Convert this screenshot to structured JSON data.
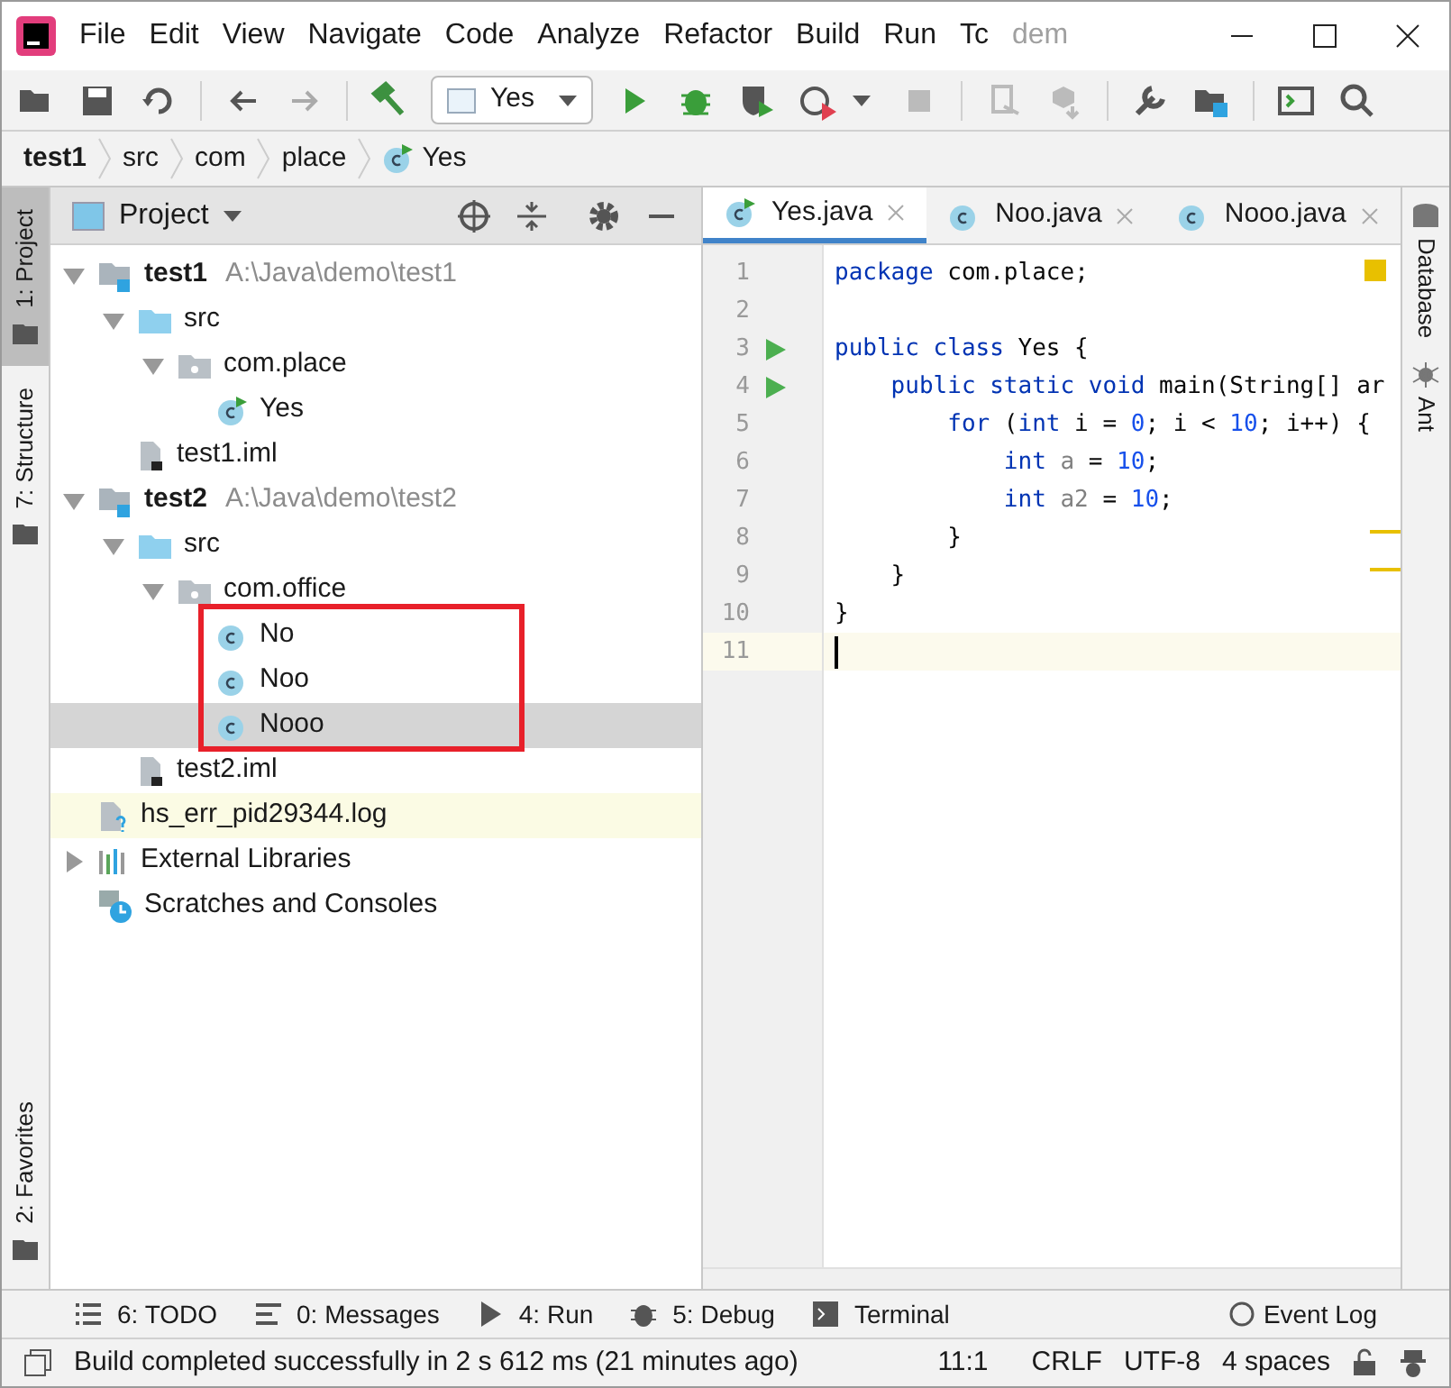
{
  "window": {
    "menu": [
      "File",
      "Edit",
      "View",
      "Navigate",
      "Code",
      "Analyze",
      "Refactor",
      "Build",
      "Run",
      "Tc"
    ],
    "title": "dem"
  },
  "toolbar": {
    "run_config": "Yes"
  },
  "breadcrumb": [
    {
      "label": "test1",
      "kind": "module"
    },
    {
      "label": "src",
      "kind": "dir"
    },
    {
      "label": "com",
      "kind": "dir"
    },
    {
      "label": "place",
      "kind": "dir"
    },
    {
      "label": "Yes",
      "kind": "class"
    }
  ],
  "left_stripe": [
    {
      "label": "1: Project",
      "selected": true
    },
    {
      "label": "7: Structure",
      "selected": false
    }
  ],
  "left_stripe_bottom": [
    {
      "label": "2: Favorites",
      "selected": false
    }
  ],
  "project_panel": {
    "title": "Project",
    "tree": [
      {
        "label": "test1",
        "path": "A:\\Java\\demo\\test1",
        "kind": "module",
        "expanded": true,
        "selected": false,
        "children": [
          {
            "label": "src",
            "kind": "src",
            "expanded": true,
            "selected": false,
            "children": [
              {
                "label": "com.place",
                "kind": "package",
                "expanded": true,
                "selected": false,
                "children": [
                  {
                    "label": "Yes",
                    "kind": "runclass",
                    "selected": false
                  }
                ]
              }
            ]
          },
          {
            "label": "test1.iml",
            "kind": "iml",
            "selected": false
          }
        ]
      },
      {
        "label": "test2",
        "path": "A:\\Java\\demo\\test2",
        "kind": "module",
        "expanded": true,
        "selected": false,
        "children": [
          {
            "label": "src",
            "kind": "src",
            "expanded": true,
            "selected": false,
            "children": [
              {
                "label": "com.office",
                "kind": "package",
                "expanded": true,
                "selected": false,
                "children": [
                  {
                    "label": "No",
                    "kind": "class",
                    "selected": false
                  },
                  {
                    "label": "Noo",
                    "kind": "class",
                    "selected": false
                  },
                  {
                    "label": "Nooo",
                    "kind": "class",
                    "selected": true
                  }
                ]
              }
            ]
          },
          {
            "label": "test2.iml",
            "kind": "iml",
            "selected": false
          }
        ]
      },
      {
        "label": "hs_err_pid29344.log",
        "kind": "log",
        "selected": false
      },
      {
        "label": "External Libraries",
        "kind": "libraries",
        "expanded": false,
        "selected": false
      },
      {
        "label": "Scratches and Consoles",
        "kind": "scratches",
        "selected": false
      }
    ]
  },
  "editor_tabs": [
    {
      "label": "Yes.java",
      "kind": "runclass",
      "selected": true
    },
    {
      "label": "Noo.java",
      "kind": "class",
      "selected": false
    },
    {
      "label": "Nooo.java",
      "kind": "class",
      "selected": false
    }
  ],
  "editor": {
    "lines": [
      {
        "number": "1",
        "tokens": [
          {
            "text": "package",
            "kind": "kw"
          },
          {
            "text": " com.place;",
            "kind": "plain"
          }
        ]
      },
      {
        "number": "2"
      },
      {
        "number": "3",
        "run": true,
        "tokens": [
          {
            "text": "public class",
            "kind": "kw"
          },
          {
            "text": " Yes {",
            "kind": "plain"
          }
        ]
      },
      {
        "number": "4",
        "run": true,
        "tokens": [
          {
            "text": "    public static void",
            "kind": "kw"
          },
          {
            "text": " main(String[] ar",
            "kind": "plain"
          }
        ]
      },
      {
        "number": "5",
        "tokens": [
          {
            "text": "        for",
            "kind": "kw"
          },
          {
            "text": " (",
            "kind": "plain"
          },
          {
            "text": "int",
            "kind": "kw"
          },
          {
            "text": " i = ",
            "kind": "plain"
          },
          {
            "text": "0",
            "kind": "num"
          },
          {
            "text": "; i < ",
            "kind": "plain"
          },
          {
            "text": "10",
            "kind": "num"
          },
          {
            "text": "; i++) {",
            "kind": "plain"
          }
        ]
      },
      {
        "number": "6",
        "tokens": [
          {
            "text": "            int",
            "kind": "kw"
          },
          {
            "text": " a",
            "kind": "unused"
          },
          {
            "text": " = ",
            "kind": "plain"
          },
          {
            "text": "10",
            "kind": "num"
          },
          {
            "text": ";",
            "kind": "plain"
          }
        ]
      },
      {
        "number": "7",
        "tokens": [
          {
            "text": "            int",
            "kind": "kw"
          },
          {
            "text": " a2",
            "kind": "unused"
          },
          {
            "text": " = ",
            "kind": "plain"
          },
          {
            "text": "10",
            "kind": "num"
          },
          {
            "text": ";",
            "kind": "plain"
          }
        ]
      },
      {
        "number": "8",
        "tokens": [
          {
            "text": "        }",
            "kind": "plain"
          }
        ]
      },
      {
        "number": "9",
        "tokens": [
          {
            "text": "    }",
            "kind": "plain"
          }
        ]
      },
      {
        "number": "10",
        "tokens": [
          {
            "text": "}",
            "kind": "plain"
          }
        ]
      },
      {
        "number": "11",
        "current": true
      }
    ]
  },
  "right_stripe": [
    "Database",
    "Ant"
  ],
  "tool_windows": [
    "6: TODO",
    "0: Messages",
    "4: Run",
    "5: Debug",
    "Terminal"
  ],
  "event_log": "Event Log",
  "status_bar": {
    "message": "Build completed successfully in 2 s 612 ms (21 minutes ago)",
    "position": "11:1",
    "line_separator": "CRLF",
    "encoding": "UTF-8",
    "indent": "4 spaces"
  }
}
